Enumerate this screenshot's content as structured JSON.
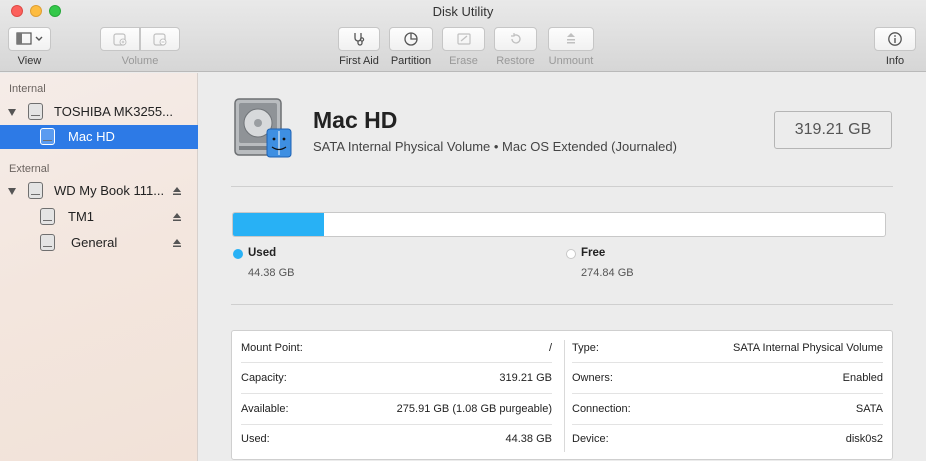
{
  "window": {
    "title": "Disk Utility"
  },
  "toolbar": {
    "view_label": "View",
    "volume_label": "Volume",
    "first_aid_label": "First Aid",
    "partition_label": "Partition",
    "erase_label": "Erase",
    "restore_label": "Restore",
    "unmount_label": "Unmount",
    "info_label": "Info"
  },
  "sidebar": {
    "internal_header": "Internal",
    "external_header": "External",
    "items": [
      {
        "label": "TOSHIBA MK3255...",
        "level": 0,
        "expanded": true
      },
      {
        "label": "Mac HD",
        "level": 1,
        "selected": true
      },
      {
        "label": "WD My Book 111...",
        "level": 0,
        "expanded": true,
        "ejectable": true
      },
      {
        "label": "TM1",
        "level": 1,
        "ejectable": true
      },
      {
        "label": "General",
        "level": 1,
        "ejectable": true
      }
    ]
  },
  "volume": {
    "name": "Mac HD",
    "subtitle": "SATA Internal Physical Volume • Mac OS Extended (Journaled)",
    "size": "319.21 GB"
  },
  "usage": {
    "used_fraction": 0.139,
    "used_label": "Used",
    "used_value": "44.38 GB",
    "free_label": "Free",
    "free_value": "274.84 GB",
    "used_color": "#28b1f5",
    "free_color": "#ffffff"
  },
  "info": {
    "left": [
      {
        "key": "Mount Point:",
        "value": "/"
      },
      {
        "key": "Capacity:",
        "value": "319.21 GB"
      },
      {
        "key": "Available:",
        "value": "275.91 GB (1.08 GB purgeable)"
      },
      {
        "key": "Used:",
        "value": "44.38 GB"
      }
    ],
    "right": [
      {
        "key": "Type:",
        "value": "SATA Internal Physical Volume"
      },
      {
        "key": "Owners:",
        "value": "Enabled"
      },
      {
        "key": "Connection:",
        "value": "SATA"
      },
      {
        "key": "Device:",
        "value": "disk0s2"
      }
    ]
  },
  "icons": {
    "view": "sidebar-icon",
    "volume_add": "add-volume-icon",
    "volume_remove": "remove-volume-icon",
    "first_aid": "stethoscope-icon",
    "partition": "pie-icon",
    "erase": "erase-icon",
    "restore": "restore-icon",
    "unmount": "unmount-icon",
    "info": "info-icon"
  }
}
